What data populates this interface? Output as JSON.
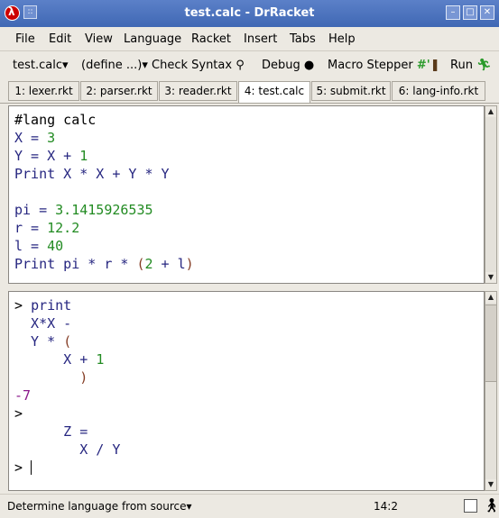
{
  "window": {
    "title": "test.calc - DrRacket",
    "menu_glyph": "::",
    "minimize": "–",
    "maximize": "□",
    "close": "✕"
  },
  "menubar": [
    "File",
    "Edit",
    "View",
    "Language",
    "Racket",
    "Insert",
    "Tabs",
    "Help"
  ],
  "toolbar": {
    "file_menu": "test.calc",
    "define_menu": "(define ...)",
    "check_syntax": "Check Syntax",
    "debug": "Debug",
    "macro_stepper": "Macro Stepper",
    "macro_glyph": "#'",
    "run": "Run"
  },
  "tabs": [
    {
      "label": "1: lexer.rkt",
      "active": false
    },
    {
      "label": "2: parser.rkt",
      "active": false
    },
    {
      "label": "3: reader.rkt",
      "active": false
    },
    {
      "label": "4: test.calc",
      "active": true
    },
    {
      "label": "5: submit.rkt",
      "active": false
    },
    {
      "label": "6: lang-info.rkt",
      "active": false
    }
  ],
  "editor_lines": [
    [
      {
        "t": "#lang calc",
        "c": "#000000"
      }
    ],
    [
      {
        "t": "X = ",
        "c": "#262680"
      },
      {
        "t": "3",
        "c": "#228b22"
      }
    ],
    [
      {
        "t": "Y = X + ",
        "c": "#262680"
      },
      {
        "t": "1",
        "c": "#228b22"
      }
    ],
    [
      {
        "t": "Print X * X + Y * Y",
        "c": "#262680"
      }
    ],
    [
      {
        "t": "",
        "c": "#000000"
      }
    ],
    [
      {
        "t": "pi = ",
        "c": "#262680"
      },
      {
        "t": "3.1415926535",
        "c": "#228b22"
      }
    ],
    [
      {
        "t": "r = ",
        "c": "#262680"
      },
      {
        "t": "12.2",
        "c": "#228b22"
      }
    ],
    [
      {
        "t": "l = ",
        "c": "#262680"
      },
      {
        "t": "40",
        "c": "#228b22"
      }
    ],
    [
      {
        "t": "Print pi * r * ",
        "c": "#262680"
      },
      {
        "t": "(",
        "c": "#843c24"
      },
      {
        "t": "2",
        "c": "#228b22"
      },
      {
        "t": " + l",
        "c": "#262680"
      },
      {
        "t": ")",
        "c": "#843c24"
      }
    ]
  ],
  "repl_lines": [
    [
      {
        "t": "> ",
        "c": "#000000"
      },
      {
        "t": "print",
        "c": "#262680"
      }
    ],
    [
      {
        "t": "  X*X -",
        "c": "#262680"
      }
    ],
    [
      {
        "t": "  Y * ",
        "c": "#262680"
      },
      {
        "t": "(",
        "c": "#843c24"
      }
    ],
    [
      {
        "t": "      X + ",
        "c": "#262680"
      },
      {
        "t": "1",
        "c": "#228b22"
      }
    ],
    [
      {
        "t": "        )",
        "c": "#843c24"
      }
    ],
    [
      {
        "t": "-7",
        "c": "#8b1a8b"
      }
    ],
    [
      {
        "t": ">",
        "c": "#000000"
      }
    ],
    [
      {
        "t": "      Z =",
        "c": "#262680"
      }
    ],
    [
      {
        "t": "        X / Y",
        "c": "#262680"
      }
    ],
    [
      {
        "t": "> ",
        "c": "#000000"
      }
    ]
  ],
  "status": {
    "language": "Determine language from source",
    "position": "14:2"
  },
  "colors": {
    "titlebar": "#4f75c0",
    "identifier": "#262680",
    "constant": "#228b22",
    "paren": "#843c24",
    "result": "#8b1a8b"
  }
}
